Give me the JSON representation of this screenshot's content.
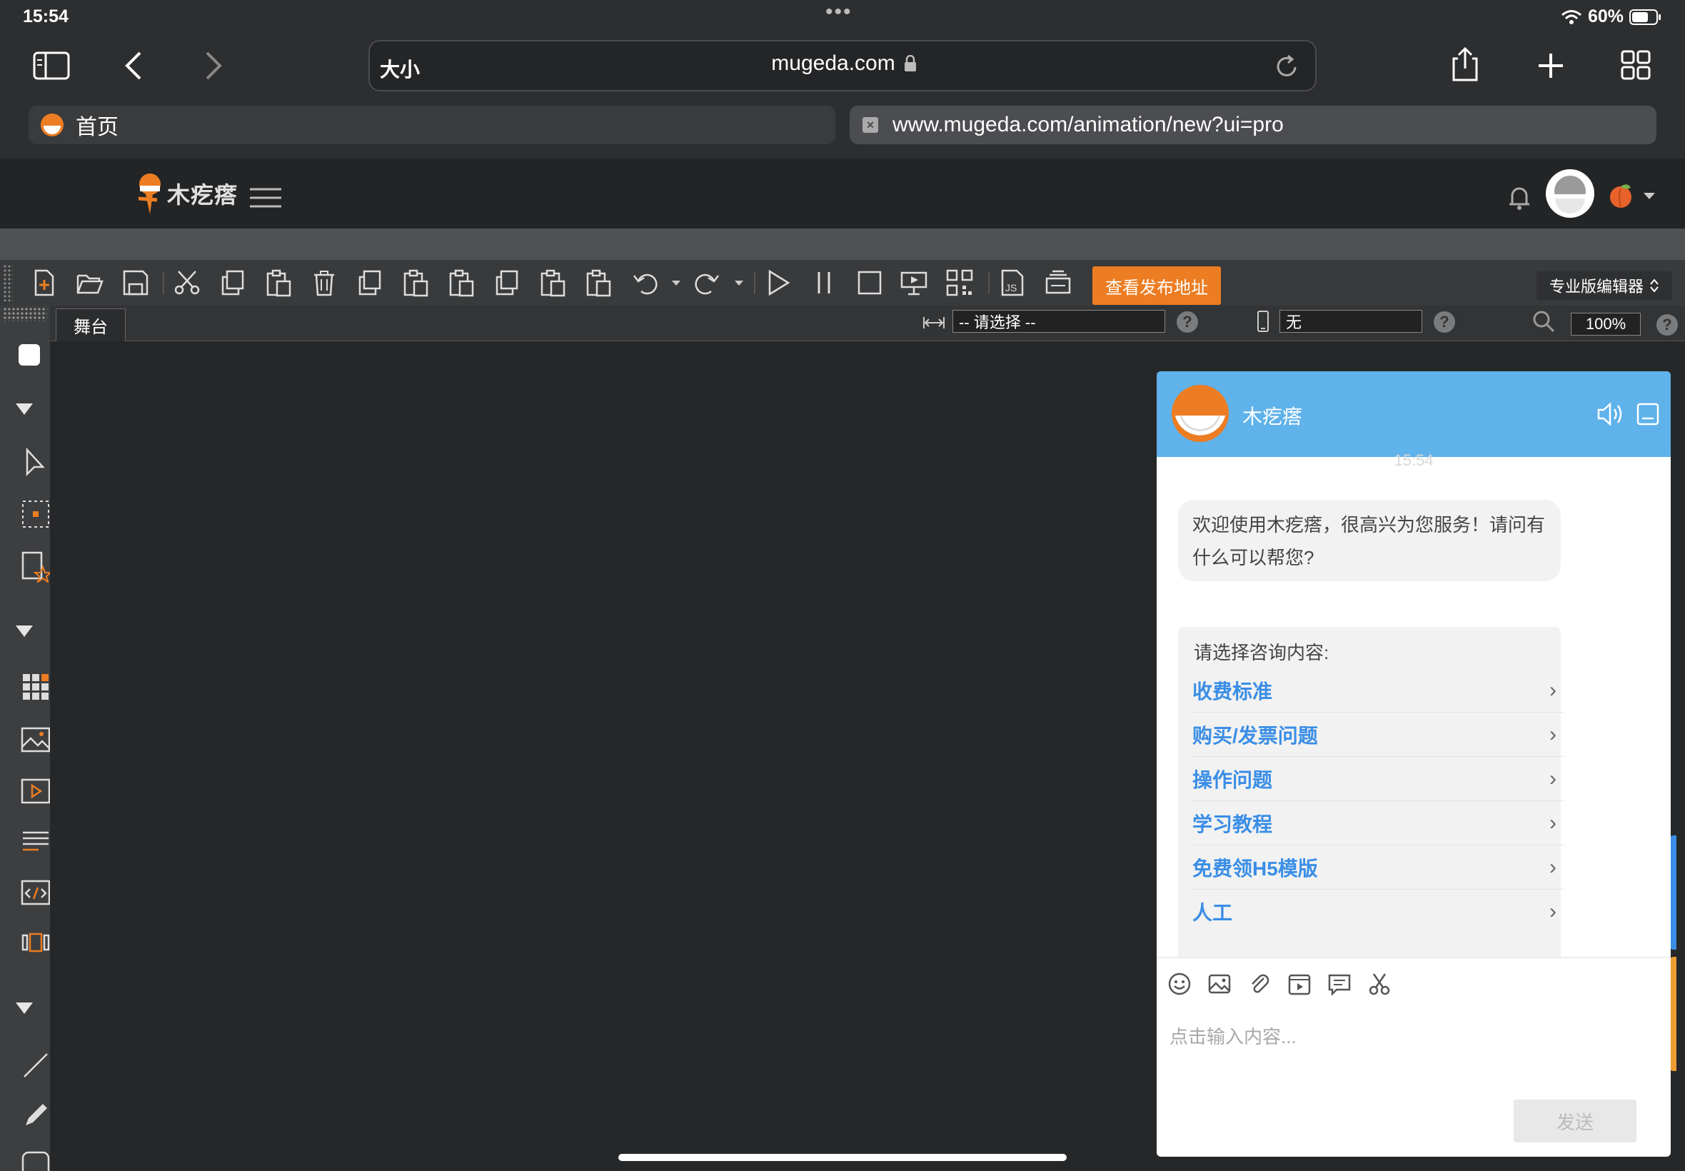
{
  "status_bar": {
    "time": "15:54",
    "dots": "•••",
    "battery": "60%"
  },
  "browser": {
    "text_size_label": "大小",
    "url": "mugeda.com",
    "tabs": [
      {
        "label": "首页",
        "active": false
      },
      {
        "label": "www.mugeda.com/animation/new?ui=pro",
        "active": true
      }
    ]
  },
  "app_header": {
    "brand": "木疙瘩"
  },
  "toolbar": {
    "publish_label": "查看发布地址",
    "editor_mode": "专业版编辑器"
  },
  "subbar": {
    "stage_tab": "舞台",
    "size_select": "-- 请选择 --",
    "device_value": "无",
    "zoom": "100%",
    "help": "?"
  },
  "chat": {
    "title": "木疙瘩",
    "timestamp": "15:54",
    "welcome": "欢迎使用木疙瘩，很高兴为您服务！请问有什么可以帮您?",
    "menu_prompt": "请选择咨询内容:",
    "menu_items": [
      "收费标准",
      "购买/发票问题",
      "操作问题",
      "学习教程",
      "免费领H5模版",
      "人工"
    ],
    "input_placeholder": "点击输入内容...",
    "send_label": "发送"
  },
  "colors": {
    "accent": "#ec7d22",
    "chat_header": "#5fb2ea",
    "link": "#3a8ee6"
  }
}
